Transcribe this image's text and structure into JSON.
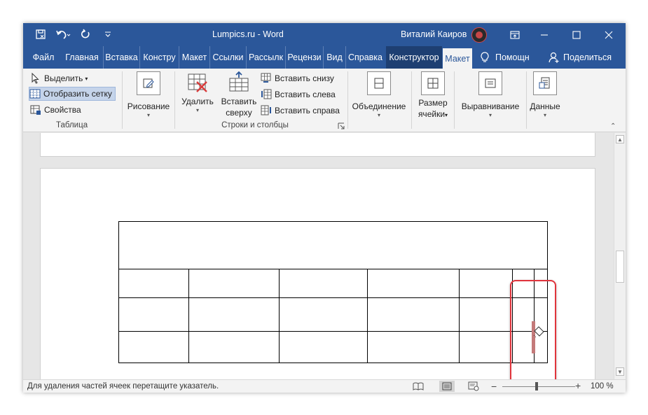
{
  "titlebar": {
    "title": "Lumpics.ru  -  Word",
    "user": "Виталий Каиров",
    "qat_icons": [
      "save-icon",
      "undo-icon",
      "redo-icon",
      "customize-icon"
    ],
    "window_icons": [
      "ribbon-display-icon",
      "minimize-icon",
      "maximize-icon",
      "close-icon"
    ]
  },
  "tabs": [
    {
      "label": "Файл"
    },
    {
      "label": "Главная"
    },
    {
      "label": "Вставка"
    },
    {
      "label": "Констру"
    },
    {
      "label": "Макет"
    },
    {
      "label": "Ссылки"
    },
    {
      "label": "Рассылк"
    },
    {
      "label": "Рецензи"
    },
    {
      "label": "Вид"
    },
    {
      "label": "Справка"
    },
    {
      "label": "Конструктор"
    },
    {
      "label": "Макет"
    },
    {
      "label": "Помощн"
    },
    {
      "label": "Поделиться"
    }
  ],
  "ribbon": {
    "table_group": {
      "select": "Выделить",
      "show_grid": "Отобразить сетку",
      "properties": "Свойства",
      "label": "Таблица"
    },
    "draw": "Рисование",
    "rows_cols": {
      "delete": "Удалить",
      "insert_above_1": "Вставить",
      "insert_above_2": "сверху",
      "insert_below": "Вставить снизу",
      "insert_left": "Вставить слева",
      "insert_right": "Вставить справа",
      "label": "Строки и столбцы"
    },
    "merge": "Объединение",
    "cell_size_1": "Размер",
    "cell_size_2": "ячейки",
    "alignment": "Выравнивание",
    "data": "Данные"
  },
  "status": {
    "text": "Для удаления частей ячеек перетащите указатель.",
    "zoom_minus": "−",
    "zoom_plus": "+",
    "zoom": "100 %",
    "zoom_fraction": 0.45
  },
  "colors": {
    "accent": "#2b579a",
    "highlight": "#e0343c",
    "eraser": "#c47a7a"
  }
}
